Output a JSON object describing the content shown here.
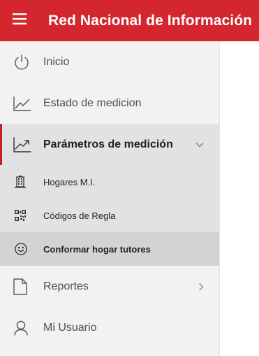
{
  "colors": {
    "header_bg": "#d3262e",
    "sidebar_bg": "#f2f2f2",
    "open_group_bg": "#e2e2e2",
    "active_item_bg": "#d3d3d3",
    "accent": "#c62026"
  },
  "header": {
    "menu_icon": "hamburger-icon",
    "title": "Red Nacional de Información"
  },
  "sidebar": {
    "items": [
      {
        "label": "Inicio",
        "icon": "power-icon"
      },
      {
        "label": "Estado de medicion",
        "icon": "line-chart-icon"
      }
    ],
    "group": {
      "label": "Parámetros de medición",
      "icon": "trend-up-icon",
      "chevron": "chevron-down-icon",
      "children": [
        {
          "label": "Hogares M.I.",
          "icon": "building-icon"
        },
        {
          "label": "Códigos de Regla",
          "icon": "qr-code-icon"
        },
        {
          "label": "Conformar hogar tutores",
          "icon": "smiley-icon",
          "active": true
        }
      ]
    },
    "bottom_items": [
      {
        "label": "Reportes",
        "icon": "document-icon",
        "chevron": "chevron-right-icon"
      },
      {
        "label": "Mi Usuario",
        "icon": "user-icon"
      }
    ]
  }
}
